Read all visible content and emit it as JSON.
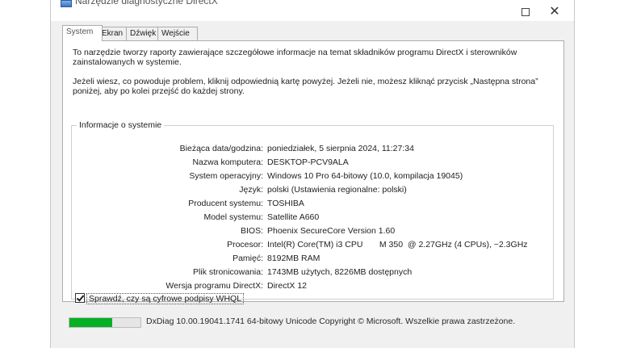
{
  "window": {
    "title": "Narzędzie diagnostyczne DirectX",
    "icons": {
      "app": "directx-app-icon",
      "maximize": "maximize-icon",
      "close": "close-icon"
    },
    "close_glyph": "✕"
  },
  "tabs": [
    {
      "label": "System",
      "active": true
    },
    {
      "label": "Ekran",
      "active": false
    },
    {
      "label": "Dźwięk",
      "active": false
    },
    {
      "label": "Wejście",
      "active": false
    }
  ],
  "intro": {
    "paragraph1": "To narzędzie tworzy raporty zawierające szczegółowe informacje na temat składników programu DirectX i sterowników zainstalowanych w systemie.",
    "paragraph2": "Jeżeli wiesz, co powoduje problem, kliknij odpowiednią kartę powyżej. Jeżeli nie, możesz kliknąć przycisk „Następna strona” poniżej, aby po kolei przejść do każdej strony."
  },
  "system_info": {
    "group_label": "Informacje o systemie",
    "rows": [
      {
        "label": "Bieżąca data/godzina:",
        "value": "poniedziałek, 5 sierpnia 2024, 11:27:34"
      },
      {
        "label": "Nazwa komputera:",
        "value": "DESKTOP-PCV9ALA"
      },
      {
        "label": "System operacyjny:",
        "value": "Windows 10 Pro 64-bitowy (10.0, kompilacja 19045)"
      },
      {
        "label": "Język:",
        "value": "polski (Ustawienia regionalne: polski)"
      },
      {
        "label": "Producent systemu:",
        "value": "TOSHIBA"
      },
      {
        "label": "Model systemu:",
        "value": "Satellite A660"
      },
      {
        "label": "BIOS:",
        "value": "Phoenix SecureCore Version 1.60"
      },
      {
        "label": "Procesor:",
        "value": "Intel(R) Core(TM) i3 CPU       M 350  @ 2.27GHz (4 CPUs), ~2.3GHz"
      },
      {
        "label": "Pamięć:",
        "value": "8192MB RAM"
      },
      {
        "label": "Plik stronicowania:",
        "value": "1743MB użytych, 8226MB dostępnych"
      },
      {
        "label": "Wersja programu DirectX:",
        "value": "DirectX 12"
      }
    ]
  },
  "whql_checkbox": {
    "label": "Sprawdź, czy są cyfrowe podpisy WHQL",
    "checked": true
  },
  "footer": {
    "progress": 0.6,
    "progress_color": "#06b025",
    "text": "DxDiag 10.00.19041.1741 64-bitowy Unicode  Copyright © Microsoft. Wszelkie prawa zastrzeżone."
  }
}
